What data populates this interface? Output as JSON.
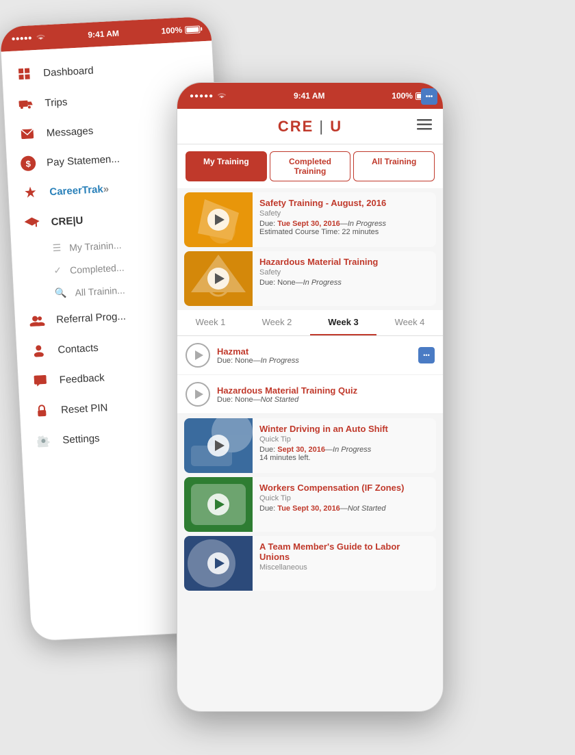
{
  "back_phone": {
    "status": {
      "signal": "●●●●●",
      "wifi": "WiFi",
      "time": "9:41 AM",
      "battery": "100%"
    },
    "sidebar": {
      "items": [
        {
          "label": "Dashboard",
          "icon": "grid"
        },
        {
          "label": "Trips",
          "icon": "truck"
        },
        {
          "label": "Messages",
          "icon": "envelope"
        },
        {
          "label": "Pay Statement",
          "icon": "dollar"
        },
        {
          "label": "CareerTrak",
          "icon": "career"
        },
        {
          "label": "CRE|U",
          "icon": "graduation"
        }
      ],
      "sub_items": [
        {
          "label": "My Training",
          "icon": "list"
        },
        {
          "label": "Completed",
          "icon": "check"
        },
        {
          "label": "All Training",
          "icon": "search"
        }
      ],
      "lower_items": [
        {
          "label": "Referral Prog...",
          "icon": "people"
        },
        {
          "label": "Contacts",
          "icon": "person"
        },
        {
          "label": "Feedback",
          "icon": "comment"
        },
        {
          "label": "Reset PIN",
          "icon": "lock"
        },
        {
          "label": "Settings",
          "icon": "gear"
        }
      ]
    }
  },
  "front_phone": {
    "status": {
      "signal": "●●●●●",
      "wifi": "WiFi",
      "time": "9:41 AM",
      "battery": "100%"
    },
    "header": {
      "logo": "CRE|U",
      "menu_icon": "≡"
    },
    "tabs": [
      {
        "label": "My Training",
        "active": true
      },
      {
        "label": "Completed Training",
        "active": false
      },
      {
        "label": "All Training",
        "active": false
      }
    ],
    "courses": [
      {
        "title": "Safety Training - August, 2016",
        "category": "Safety",
        "due": "Tue Sept 30, 2016",
        "status": "In Progress",
        "time": "Estimated Course Time: 22 minutes",
        "thumb_color": "orange",
        "badge": "!",
        "badge_color": "red"
      },
      {
        "title": "Hazardous Material Training",
        "category": "Safety",
        "due": "None",
        "status": "In Progress",
        "thumb_color": "orange2",
        "badge": "...",
        "badge_color": "blue"
      }
    ],
    "week_tabs": [
      {
        "label": "Week 1"
      },
      {
        "label": "Week 2"
      },
      {
        "label": "Week 3",
        "active": true
      },
      {
        "label": "Week 4"
      }
    ],
    "list_items": [
      {
        "title": "Hazmat",
        "due": "None",
        "status": "In Progress",
        "badge": "blue"
      },
      {
        "title": "Hazardous Material Training Quiz",
        "due": "None",
        "status": "Not Started"
      }
    ],
    "more_courses": [
      {
        "title": "Winter Driving in an Auto Shift",
        "category": "Quick Tip",
        "due": "Sept 30, 2016",
        "status": "In Progress",
        "extra": "14 minutes left.",
        "thumb_color": "blue",
        "badge_red": true,
        "badge_blue": true
      },
      {
        "title": "Workers Compensation (IF Zones)",
        "category": "Quick Tip",
        "due": "Tue Sept 30, 2016",
        "status": "Not Started",
        "thumb_color": "green"
      },
      {
        "title": "A Team Member's Guide to Labor Unions",
        "category": "Miscellaneous",
        "due": "",
        "status": "",
        "thumb_color": "navy"
      }
    ]
  }
}
